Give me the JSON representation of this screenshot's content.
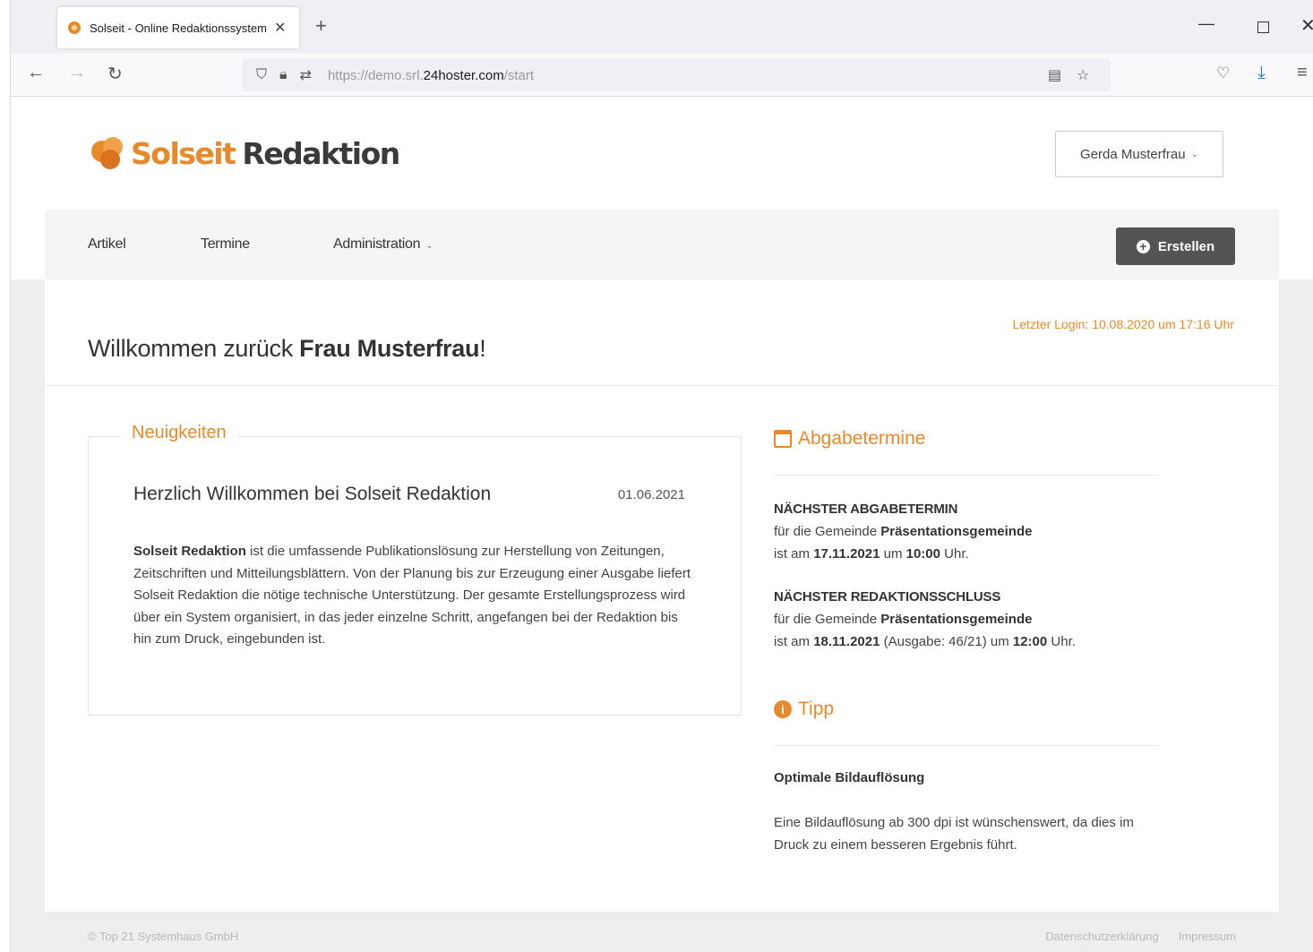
{
  "browser": {
    "tab_title": "Solseit - Online Redaktionssystem",
    "url_prefix": "https://demo.srl.",
    "url_domain": "24hoster.com",
    "url_path": "/start"
  },
  "header": {
    "logo_brand": "Solseit",
    "logo_product": "Redaktion",
    "user_name": "Gerda Musterfrau"
  },
  "nav": {
    "items": [
      {
        "label": "Artikel"
      },
      {
        "label": "Termine"
      },
      {
        "label": "Administration"
      }
    ],
    "create_label": "Erstellen"
  },
  "welcome": {
    "greeting": "Willkommen zurück ",
    "name": "Frau Musterfrau",
    "suffix": "!",
    "last_login": "Letzter Login: 10.08.2020 um 17:16 Uhr"
  },
  "news": {
    "legend": "Neuigkeiten",
    "title": "Herzlich Willkommen bei Solseit Redaktion",
    "date": "01.06.2021",
    "body_bold": "Solseit Redaktion",
    "body_text": " ist die umfassende Publikationslösung zur Herstellung von Zeitungen, Zeitschriften und Mitteilungsblättern. Von der Planung bis zur Erzeugung einer Ausgabe liefert Solseit Redaktion die nötige technische Unterstützung. Der gesamte Erstellungsprozess wird über ein System organisiert, in das jeder einzelne Schritt, angefangen bei der Redaktion bis hin zum Druck, eingebunden ist."
  },
  "deadlines": {
    "heading": "Abgabetermine",
    "next_submission": {
      "label": "Nächster Abgabetermin",
      "for_text": "für die Gemeinde ",
      "community": "Präsentationsgemeinde",
      "is_on": "ist am ",
      "date": "17.11.2021",
      "at": " um ",
      "time": "10:00",
      "uhr": " Uhr."
    },
    "next_editorial": {
      "label": "Nächster Redaktionsschluss",
      "for_text": "für die Gemeinde ",
      "community": "Präsentationsgemeinde",
      "is_on": "ist am ",
      "date": "18.11.2021",
      "issue": " (Ausgabe: 46/21) um ",
      "time": "12:00",
      "uhr": " Uhr."
    }
  },
  "tip": {
    "heading": "Tipp",
    "title": "Optimale Bildauflösung",
    "body": "Eine Bildauflösung ab 300 dpi ist wünschenswert, da dies im Druck zu einem besseren Ergebnis führt."
  },
  "footer": {
    "copyright": "© Top 21 Systemhaus GmbH",
    "privacy": "Datenschutzerklärung",
    "imprint": "Impressum"
  }
}
